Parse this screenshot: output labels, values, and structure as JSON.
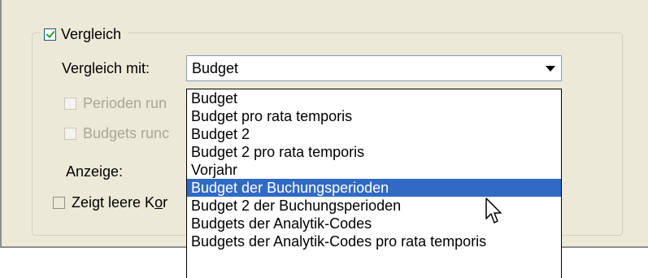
{
  "group": {
    "label": "Vergleich",
    "checked": true
  },
  "compare": {
    "label": "Vergleich mit:",
    "selected": "Budget",
    "options": [
      "Budget",
      "Budget pro rata temporis",
      "Budget 2",
      "Budget 2 pro rata temporis",
      "Vorjahr",
      "Budget der Buchungsperioden",
      "Budget 2 der Buchungsperioden",
      "Budgets der Analytik-Codes",
      "Budgets der Analytik-Codes pro rata temporis"
    ],
    "highlighted_index": 5
  },
  "options": {
    "perioden_label": "Perioden run",
    "budgets_label": "Budgets runc",
    "anzeige_label": "Anzeige:",
    "leere_label_pre": "Zeigt leere K",
    "leere_label_ul": "o",
    "leere_label_post": "r"
  },
  "colors": {
    "highlight": "#316ac5",
    "dialog_bg": "#ece9d8"
  }
}
